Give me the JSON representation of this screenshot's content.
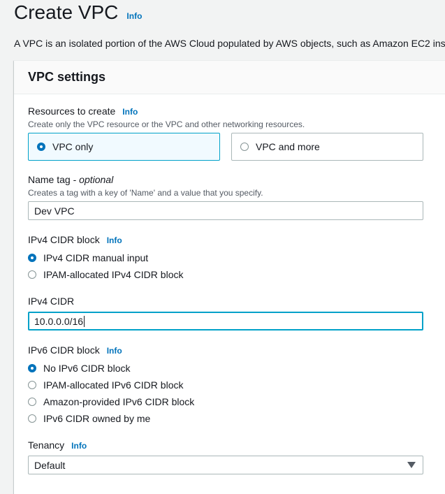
{
  "header": {
    "title": "Create VPC",
    "info": "Info",
    "description": "A VPC is an isolated portion of the AWS Cloud populated by AWS objects, such as Amazon EC2 ins"
  },
  "panel": {
    "title": "VPC settings"
  },
  "resources": {
    "label": "Resources to create",
    "info": "Info",
    "description": "Create only the VPC resource or the VPC and other networking resources.",
    "options": [
      {
        "label": "VPC only",
        "selected": true
      },
      {
        "label": "VPC and more",
        "selected": false
      }
    ]
  },
  "name_tag": {
    "label": "Name tag",
    "optional": "optional",
    "description": "Creates a tag with a key of 'Name' and a value that you specify.",
    "value": "Dev VPC"
  },
  "ipv4_block": {
    "label": "IPv4 CIDR block",
    "info": "Info",
    "options": [
      {
        "label": "IPv4 CIDR manual input",
        "selected": true
      },
      {
        "label": "IPAM-allocated IPv4 CIDR block",
        "selected": false
      }
    ]
  },
  "ipv4_cidr": {
    "label": "IPv4 CIDR",
    "value": "10.0.0.0/16"
  },
  "ipv6_block": {
    "label": "IPv6 CIDR block",
    "info": "Info",
    "options": [
      {
        "label": "No IPv6 CIDR block",
        "selected": true
      },
      {
        "label": "IPAM-allocated IPv6 CIDR block",
        "selected": false
      },
      {
        "label": "Amazon-provided IPv6 CIDR block",
        "selected": false
      },
      {
        "label": "IPv6 CIDR owned by me",
        "selected": false
      }
    ]
  },
  "tenancy": {
    "label": "Tenancy",
    "info": "Info",
    "value": "Default"
  },
  "colors": {
    "accent": "#0073bb",
    "selected_border": "#00a1c9",
    "selected_bg": "#f1faff"
  }
}
